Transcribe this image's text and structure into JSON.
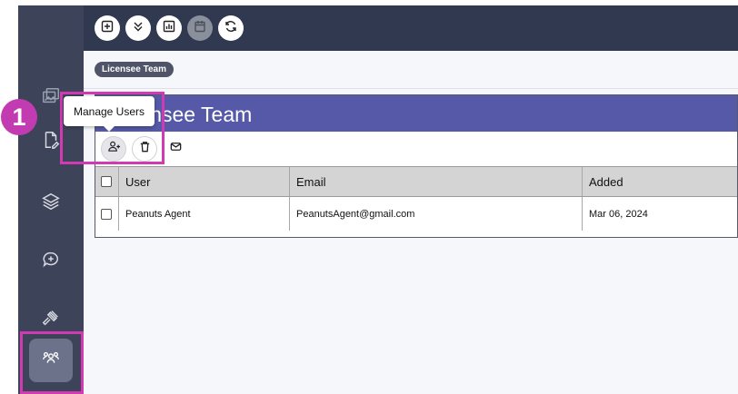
{
  "topbar": {
    "buttons": [
      {
        "icon": "plus-square-icon"
      },
      {
        "icon": "chevrons-down-icon"
      },
      {
        "icon": "bar-chart-icon"
      },
      {
        "icon": "calendar-icon",
        "disabled": true
      },
      {
        "icon": "refresh-icon"
      }
    ]
  },
  "sidebar": {
    "items": [
      {
        "icon": "images-icon"
      },
      {
        "icon": "file-edit-icon"
      },
      {
        "icon": "layers-icon"
      },
      {
        "icon": "message-plus-icon"
      },
      {
        "icon": "gavel-icon"
      },
      {
        "icon": "users-icon",
        "active": true
      }
    ]
  },
  "breadcrumb": {
    "label": "Licensee Team"
  },
  "panel": {
    "title": "Licensee Team"
  },
  "toolbar": {
    "buttons": [
      {
        "icon": "add-user-icon",
        "active": true
      },
      {
        "icon": "trash-icon"
      },
      {
        "icon": "mail-icon"
      }
    ]
  },
  "table": {
    "columns": [
      "User",
      "Email",
      "Added"
    ],
    "rows": [
      {
        "user": "Peanuts Agent",
        "email": "PeanutsAgent@gmail.com",
        "added": "Mar 06, 2024"
      }
    ]
  },
  "tooltip": {
    "text": "Manage Users"
  },
  "annotation": {
    "step": "1"
  },
  "colors": {
    "sidebar": "#3d4459",
    "topbar": "#313950",
    "header": "#5559a7",
    "highlight": "#d23ab4",
    "badge": "#c23bb0"
  }
}
